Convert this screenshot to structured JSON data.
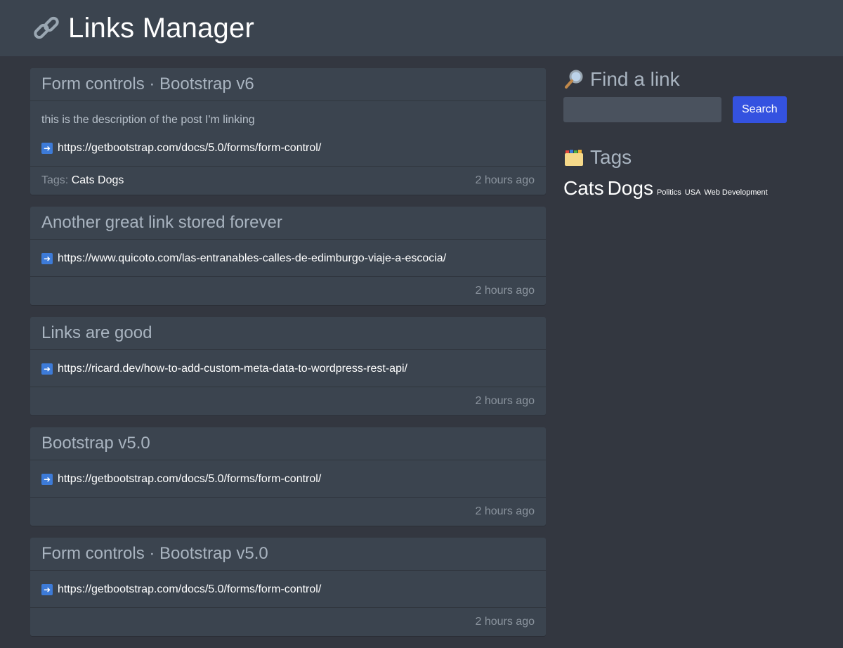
{
  "header": {
    "title": "Links Manager",
    "logo_icon": "link-icon"
  },
  "links": [
    {
      "title": "Form controls · Bootstrap v6",
      "description": "this is the description of the post I'm linking",
      "url": "https://getbootstrap.com/docs/5.0/forms/form-control/",
      "tags_label": "Tags:",
      "tags": "Cats Dogs",
      "time": "2 hours ago"
    },
    {
      "title": "Another great link stored forever",
      "url": "https://www.quicoto.com/las-entranables-calles-de-edimburgo-viaje-a-escocia/",
      "time": "2 hours ago"
    },
    {
      "title": "Links are good",
      "url": "https://ricard.dev/how-to-add-custom-meta-data-to-wordpress-rest-api/",
      "time": "2 hours ago"
    },
    {
      "title": "Bootstrap v5.0",
      "url": "https://getbootstrap.com/docs/5.0/forms/form-control/",
      "time": "2 hours ago"
    },
    {
      "title": "Form controls · Bootstrap v5.0",
      "url": "https://getbootstrap.com/docs/5.0/forms/form-control/",
      "time": "2 hours ago"
    }
  ],
  "sidebar": {
    "search_title": "Find a link",
    "search_icon": "magnifier-icon",
    "search_placeholder": "",
    "search_button": "Search",
    "tags_title": "Tags",
    "tags_icon": "folder-icon",
    "tags": [
      {
        "name": "Cats",
        "size": "big"
      },
      {
        "name": "Dogs",
        "size": "big"
      },
      {
        "name": "Politics",
        "size": "small"
      },
      {
        "name": "USA",
        "size": "small"
      },
      {
        "name": "Web Development",
        "size": "small"
      }
    ]
  },
  "colors": {
    "accent": "#3452e0",
    "background": "#333740",
    "card": "#3b444f"
  }
}
